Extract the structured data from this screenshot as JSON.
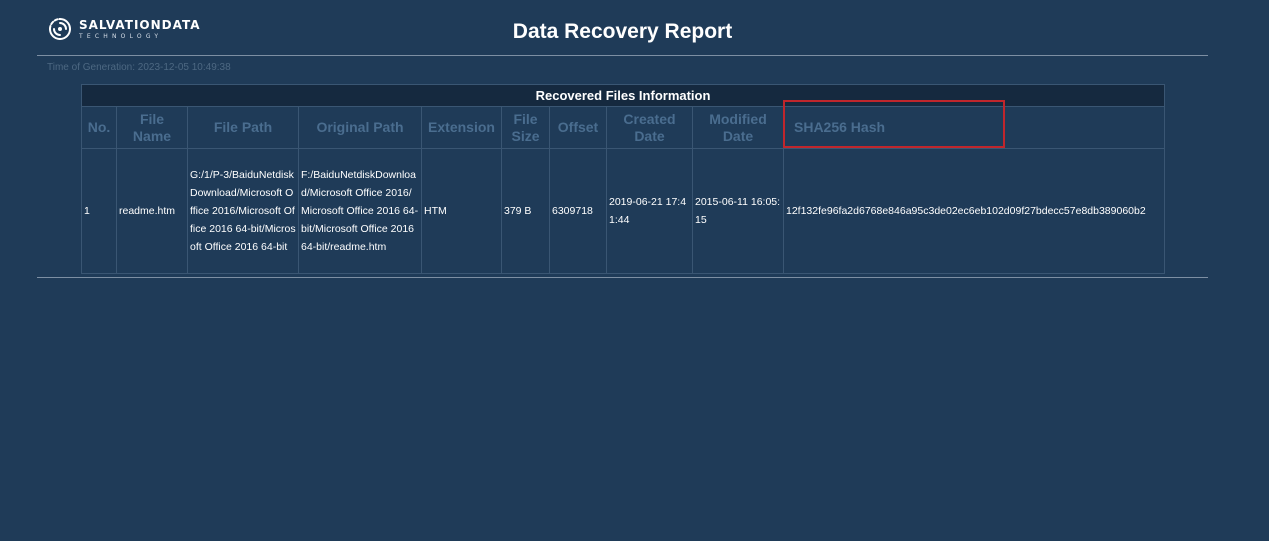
{
  "header": {
    "logo_text": "SALVATIONDATA",
    "logo_sub": "TECHNOLOGY",
    "title": "Data Recovery Report"
  },
  "generation": {
    "label": "Time of Generation:",
    "value": "2023-12-05 10:49:38"
  },
  "table": {
    "caption": "Recovered Files Information",
    "columns": [
      "No.",
      "File Name",
      "File Path",
      "Original Path",
      "Extension",
      "File Size",
      "Offset",
      "Created Date",
      "Modified Date",
      "SHA256 Hash"
    ],
    "rows": [
      {
        "no": "1",
        "file_name": "readme.htm",
        "file_path": "G:/1/P-3/BaiduNetdiskDownload/Microsoft Office 2016/Microsoft Office 2016 64-bit/Microsoft Office 2016 64-bit",
        "original_path": "F:/BaiduNetdiskDownload/Microsoft Office 2016/Microsoft Office 2016 64-bit/Microsoft Office 2016 64-bit/readme.htm",
        "extension": "HTM",
        "file_size": "379 B",
        "offset": "6309718",
        "created_date": "2019-06-21 17:41:44",
        "modified_date": "2015-06-11 16:05:15",
        "sha256": "12f132fe96fa2d6768e846a95c3de02ec6eb102d09f27bdecc57e8db389060b2"
      }
    ]
  },
  "colors": {
    "background": "#1f3b58",
    "caption_bg": "#15293f",
    "header_text": "#4a6d8f",
    "highlight": "#c0262c"
  }
}
